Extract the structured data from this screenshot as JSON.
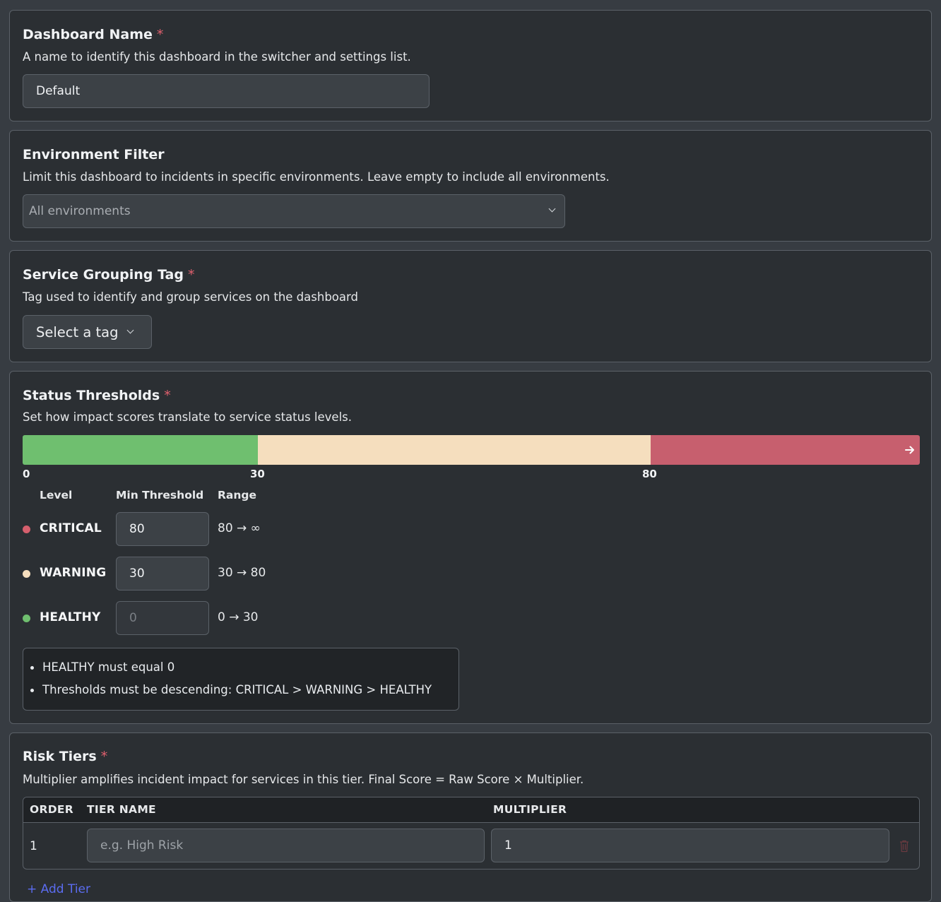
{
  "dashboard_name": {
    "label": "Dashboard Name",
    "required_mark": "*",
    "description": "A name to identify this dashboard in the switcher and settings list.",
    "value": "Default"
  },
  "environment_filter": {
    "label": "Environment Filter",
    "description": "Limit this dashboard to incidents in specific environments. Leave empty to include all environments.",
    "placeholder": "All environments"
  },
  "service_grouping_tag": {
    "label": "Service Grouping Tag",
    "required_mark": "*",
    "description": "Tag used to identify and group services on the dashboard",
    "select_label": "Select a tag"
  },
  "status_thresholds": {
    "label": "Status Thresholds",
    "required_mark": "*",
    "description": "Set how impact scores translate to service status levels.",
    "bar": {
      "ticks": [
        "0",
        "30",
        "80"
      ],
      "segment_fractions": [
        0.262,
        0.438,
        0.3
      ],
      "colors": {
        "healthy": "#6fbf6f",
        "warning": "#f5debe",
        "critical": "#c75f6e"
      }
    },
    "columns": {
      "level": "Level",
      "min_threshold": "Min Threshold",
      "range": "Range"
    },
    "levels": [
      {
        "name": "CRITICAL",
        "value": "80",
        "range": "80 → ∞"
      },
      {
        "name": "WARNING",
        "value": "30",
        "range": "30 → 80"
      },
      {
        "name": "HEALTHY",
        "placeholder": "0",
        "range": "0 → 30"
      }
    ],
    "rules": [
      "HEALTHY must equal 0",
      "Thresholds must be descending: CRITICAL > WARNING > HEALTHY"
    ]
  },
  "risk_tiers": {
    "label": "Risk Tiers",
    "required_mark": "*",
    "description": "Multiplier amplifies incident impact for services in this tier. Final Score = Raw Score × Multiplier.",
    "columns": {
      "order": "ORDER",
      "tier_name": "TIER NAME",
      "multiplier": "MULTIPLIER"
    },
    "rows": [
      {
        "order": "1",
        "tier_name_placeholder": "e.g. High Risk",
        "multiplier": "1"
      }
    ],
    "add_label": "+ Add Tier"
  }
}
